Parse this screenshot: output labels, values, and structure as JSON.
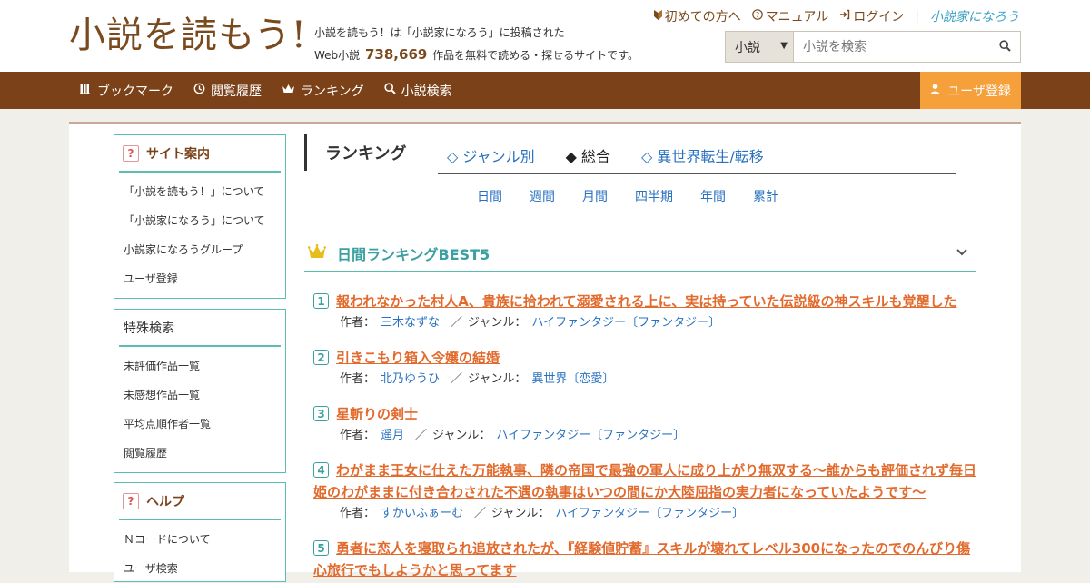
{
  "header": {
    "logo": "小説を読もう!",
    "tagline_line1": "小説を読もう！は「小説家になろう」に投稿された",
    "tagline_prefix": "Web小説",
    "work_count": "738,669",
    "tagline_suffix": "作品を無料で読める・探せるサイトです。",
    "links": {
      "first_time": "初めての方へ",
      "manual": "マニュアル",
      "login": "ログイン",
      "brand": "小説家になろう"
    },
    "search": {
      "category": "小説",
      "placeholder": "小説を検索"
    }
  },
  "nav": {
    "bookmark": "ブックマーク",
    "history": "閲覧履歴",
    "ranking": "ランキング",
    "search": "小説検索",
    "register": "ユーザ登録"
  },
  "sidebar": {
    "site_guide": {
      "title": "サイト案内",
      "items": [
        "「小説を読もう！」について",
        "「小説家になろう」について",
        "小説家になろうグループ",
        "ユーザ登録"
      ]
    },
    "special_search": {
      "title": "特殊検索",
      "items": [
        "未評価作品一覧",
        "未感想作品一覧",
        "平均点順作者一覧",
        "閲覧履歴"
      ]
    },
    "help": {
      "title": "ヘルプ",
      "items": [
        "Ｎコードについて",
        "ユーザ検索"
      ]
    }
  },
  "main": {
    "heading": "ランキング",
    "tabs": [
      "◇ ジャンル別",
      "◆ 総合",
      "◇ 異世界転生/転移"
    ],
    "periods": [
      "日間",
      "週間",
      "月間",
      "四半期",
      "年間",
      "累計"
    ],
    "section_title": "日間ランキングBEST5",
    "labels": {
      "author": "作者：",
      "genre": "ジャンル：",
      "slash": "／"
    },
    "entries": [
      {
        "rank": "1",
        "title": "報われなかった村人A、貴族に拾われて溺愛される上に、実は持っていた伝説級の神スキルも覚醒した",
        "author": "三木なずな",
        "genre": "ハイファンタジー〔ファンタジー〕"
      },
      {
        "rank": "2",
        "title": "引きこもり箱入令嬢の結婚",
        "author": "北乃ゆうひ",
        "genre": "異世界〔恋愛〕"
      },
      {
        "rank": "3",
        "title": "星斬りの剣士",
        "author": "遥月",
        "genre": "ハイファンタジー〔ファンタジー〕"
      },
      {
        "rank": "4",
        "title": "わがまま王女に仕えた万能執事、隣の帝国で最強の軍人に成り上がり無双する〜誰からも評価されず毎日姫のわがままに付き合わされた不遇の執事はいつの間にか大陸屈指の実力者になっていたようです〜",
        "author": "すかいふぁーむ",
        "genre": "ハイファンタジー〔ファンタジー〕"
      },
      {
        "rank": "5",
        "title": "勇者に恋人を寝取られ追放されたが、『経験値貯蓄』スキルが壊れてレベル300になったのでのんびり傷心旅行でもしようかと思ってます"
      }
    ]
  }
}
